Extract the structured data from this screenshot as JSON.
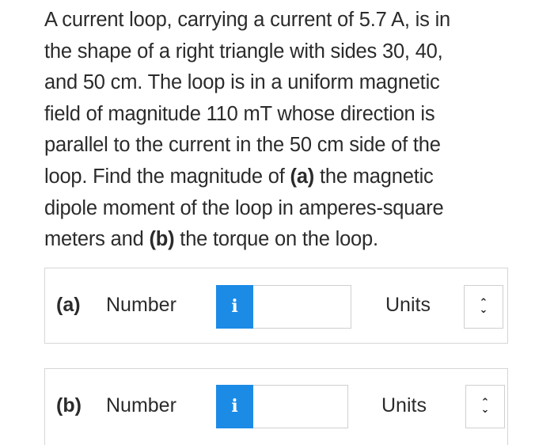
{
  "question": {
    "line1": "A current loop, carrying a current of 5.7 A, is in",
    "line2": "the shape of a right triangle with sides 30, 40,",
    "line3": "and 50 cm. The loop is in a uniform magnetic",
    "line4": "field of magnitude 110 mT whose direction is",
    "line5": "parallel to the current in the 50 cm side of the",
    "line6_pre": "loop. Find the magnitude of ",
    "line6_a": "(a)",
    "line6_post": " the magnetic",
    "line7": "dipole moment of the loop in amperes-square",
    "line8_pre": "meters and ",
    "line8_b": "(b)",
    "line8_post": " the torque on the loop."
  },
  "parts": {
    "a": {
      "label": "(a)",
      "number_label": "Number",
      "info_icon": "i",
      "number_value": "",
      "units_label": "Units",
      "units_selected": ""
    },
    "b": {
      "label": "(b)",
      "number_label": "Number",
      "info_icon": "i",
      "number_value": "",
      "units_label": "Units",
      "units_selected": ""
    }
  },
  "icons": {
    "info": "info-icon",
    "units_select": "chevron-up-down-icon"
  },
  "colors": {
    "info_button": "#1c8be6",
    "text": "#2b2b2b",
    "border": "#d6d6d6"
  }
}
